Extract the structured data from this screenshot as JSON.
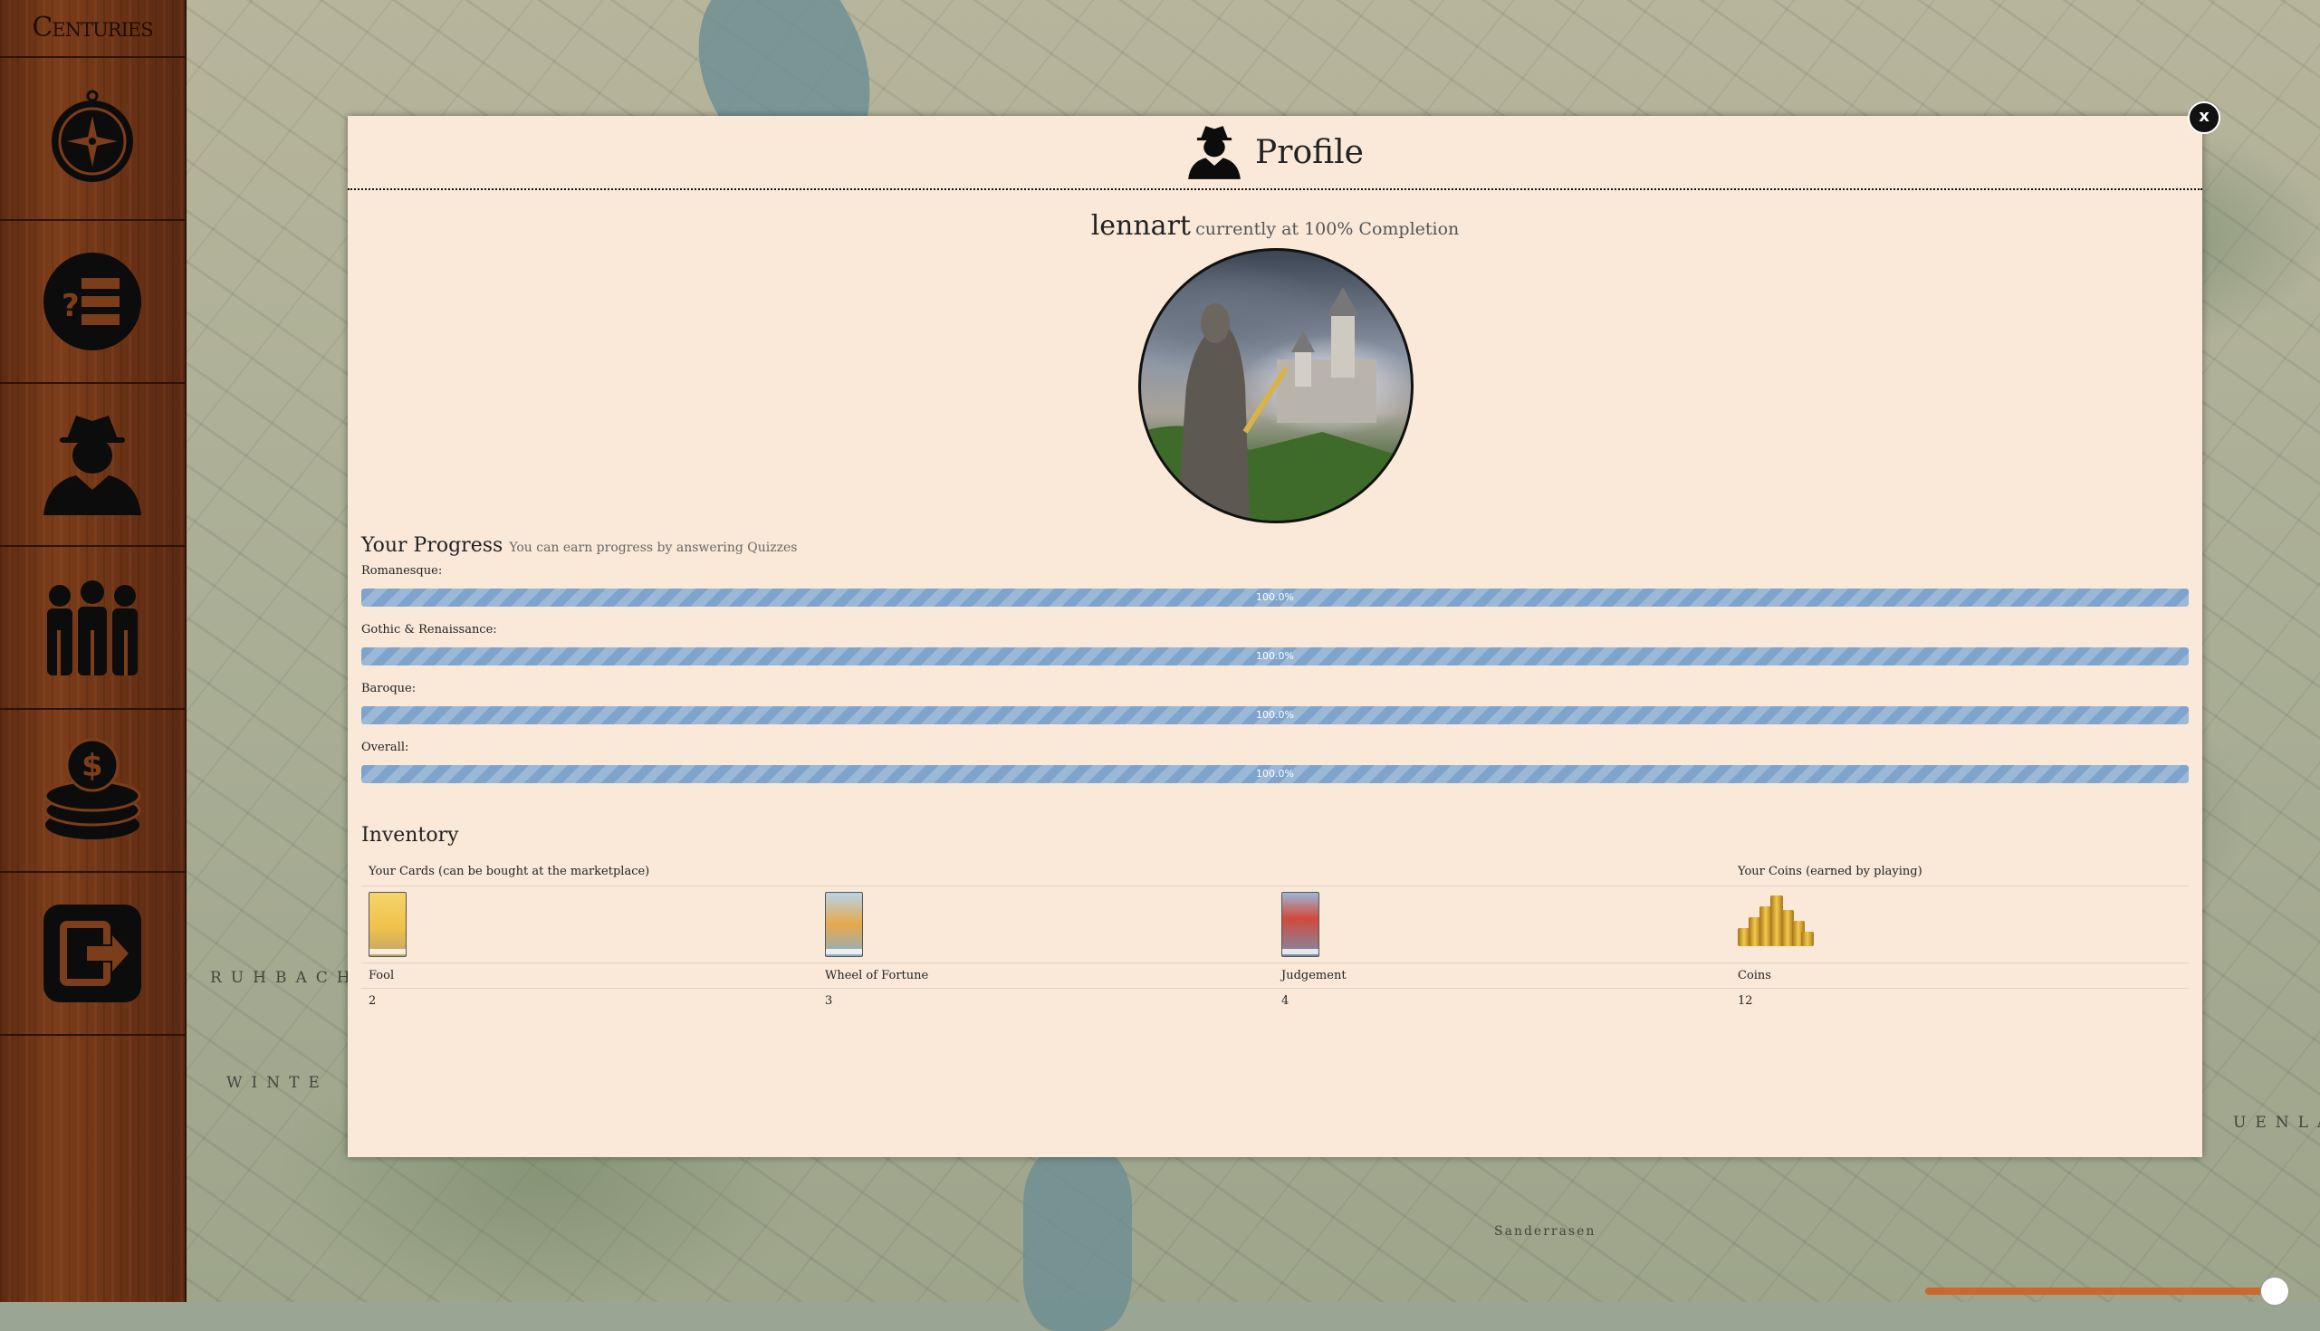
{
  "app": {
    "brand": "Centuries"
  },
  "map_words": [
    "RUHBACH",
    "WINTE",
    "UENLA",
    "Sanderrasen"
  ],
  "sidebar": {
    "items": [
      {
        "icon": "compass-icon"
      },
      {
        "icon": "quiz-list-icon"
      },
      {
        "icon": "profile-icon"
      },
      {
        "icon": "group-icon"
      },
      {
        "icon": "coins-icon"
      },
      {
        "icon": "logout-icon"
      }
    ]
  },
  "modal": {
    "close_label": "x",
    "title": "Profile",
    "username": "lennart",
    "completion_text": "currently at 100% Completion",
    "progress": {
      "heading": "Your Progress",
      "hint": "You can earn progress by answering Quizzes",
      "rows": [
        {
          "label": "Romanesque:",
          "value_text": "100.0%",
          "percent": 100
        },
        {
          "label": "Gothic & Renaissance:",
          "value_text": "100.0%",
          "percent": 100
        },
        {
          "label": "Baroque:",
          "value_text": "100.0%",
          "percent": 100
        },
        {
          "label": "Overall:",
          "value_text": "100.0%",
          "percent": 100
        }
      ]
    },
    "inventory": {
      "heading": "Inventory",
      "cards_header": "Your Cards (can be bought at the marketplace)",
      "coins_header": "Your Coins (earned by playing)",
      "items": [
        {
          "name": "Fool",
          "count": "2"
        },
        {
          "name": "Wheel of Fortune",
          "count": "3"
        },
        {
          "name": "Judgement",
          "count": "4"
        },
        {
          "name": "Coins",
          "count": "12"
        }
      ]
    }
  },
  "colors": {
    "modal_bg": "#fae9d8",
    "progress_bar": "#7fa4cc",
    "sidebar_wood": "#6d3416"
  }
}
